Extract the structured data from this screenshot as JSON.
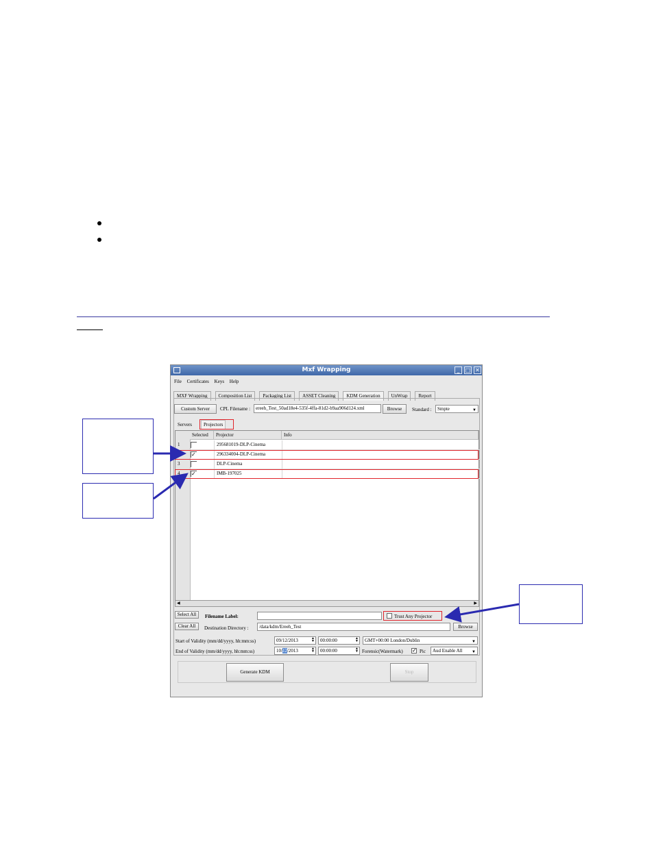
{
  "window": {
    "title": "Mxf Wrapping",
    "menu": [
      "File",
      "Certificates",
      "Keys",
      "Help"
    ],
    "tabs": [
      "MXF Wrapping",
      "Composition List",
      "Packaging List",
      "ASSET Cleaning",
      "KDM Generation",
      "UnWrap",
      "Report"
    ],
    "active_tab": "KDM Generation"
  },
  "toolbar": {
    "custom_server_label": "Custom Server",
    "cpl_label": "CPL Filename :",
    "cpl_value": "ereeh_Test_50ad18e4-535f-4ffa-81d2-b9aa906d124.xml",
    "browse_label": "Browse",
    "standard_label": "Standard :",
    "standard_value": "Smpte"
  },
  "subtabs": [
    "Servers",
    "Projectors"
  ],
  "grid": {
    "columns": [
      "Selected",
      "Projector",
      "Info"
    ],
    "rows": [
      {
        "num": "1",
        "checked": "",
        "projector": "295681019-DLP-Cinema",
        "info": ""
      },
      {
        "num": "2",
        "checked": "✓",
        "projector": "296334004-DLP-Cinema",
        "info": ""
      },
      {
        "num": "3",
        "checked": "",
        "projector": "DLP-Cinema",
        "info": ""
      },
      {
        "num": "4",
        "checked": "✓",
        "projector": "IMB-197025",
        "info": ""
      }
    ]
  },
  "bottom": {
    "select_all": "Select All",
    "clear_all": "Clear All",
    "filename_label": "Filename Label:",
    "filename_value": "",
    "trust_any_projector": "Trust Any Projector",
    "destination_label": "Destination Directory :",
    "destination_value": "/data/kdm/Ereeh_Test",
    "browse_label": "Browse",
    "start_label": "Start of Validity (mm/dd/yyyy, hh:mm:ss)",
    "start_date": "09/12/2013",
    "start_time": "00:00:00",
    "timezone": "GMT+00:00 London/Dublin",
    "end_label": "End of Validity (mm/dd/yyyy, hh:mm:ss)",
    "end_date_pre": "10/",
    "end_date_hl": "12",
    "end_date_post": "/2013",
    "end_time": "00:00:00",
    "forensic_label": "Forensic(Watermark)",
    "pic_label": "Pic",
    "aud_value": "Aud Enable All"
  },
  "actions": {
    "generate_kdm": "Generate KDM",
    "stop": "Stop"
  }
}
